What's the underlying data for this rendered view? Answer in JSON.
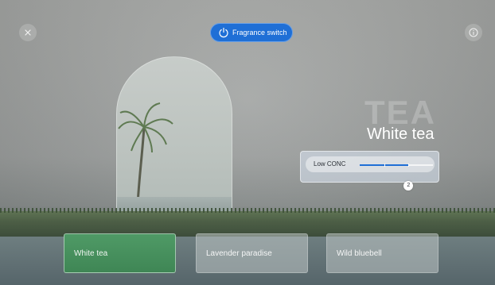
{
  "header": {
    "close_icon": "close-icon",
    "info_icon": "info-icon",
    "fragrance_switch_label": "Fragrance switch",
    "power_icon": "power-icon",
    "accent": "#1f6fd6"
  },
  "scene": {
    "ghost_text": "TEA",
    "title": "White tea"
  },
  "concentration": {
    "label": "Low CONC",
    "level": 2,
    "max_level": 3,
    "knob_label": "2"
  },
  "fragrances": [
    {
      "label": "White tea",
      "selected": true
    },
    {
      "label": "Lavender paradise",
      "selected": false
    },
    {
      "label": "Wild bluebell",
      "selected": false
    }
  ]
}
